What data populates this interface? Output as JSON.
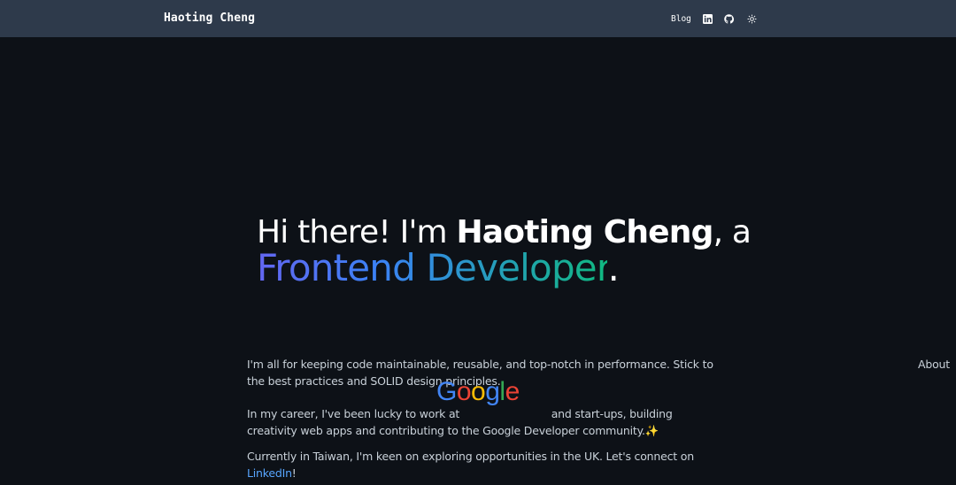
{
  "nav": {
    "brand": "Haoting Cheng",
    "links": [
      "About",
      "Blog"
    ],
    "icons": [
      "linkedin-icon",
      "github-icon",
      "theme-toggle-icon"
    ]
  },
  "hero": {
    "intro": "Hi there! I'm ",
    "name": "Haoting Cheng",
    "after_name": ", a",
    "role": "Frontend Developer",
    "end": "."
  },
  "about": {
    "p1": "I'm all for keeping code maintainable, reusable, and top-notch in performance. Stick to the best practices and SOLID design principles.",
    "p2_before": "In my career, I've been lucky to work at",
    "p2_after": "and start-ups, building creativity web apps and contributing to the Google Developer community.",
    "p2_emoji": "✨",
    "google_letters": [
      "G",
      "o",
      "o",
      "g",
      "l",
      "e"
    ],
    "p3_before": "Currently in Taiwan, I'm keen on exploring opportunities in the UK. Let's connect on ",
    "p3_link": "LinkedIn",
    "p3_after": "!"
  },
  "colors": {
    "navbar_bg": "#2e3a4b",
    "page_bg": "#0d1117",
    "link": "#58a6ff",
    "gradient": [
      "#6366f1",
      "#3b82f6",
      "#10b981"
    ]
  }
}
